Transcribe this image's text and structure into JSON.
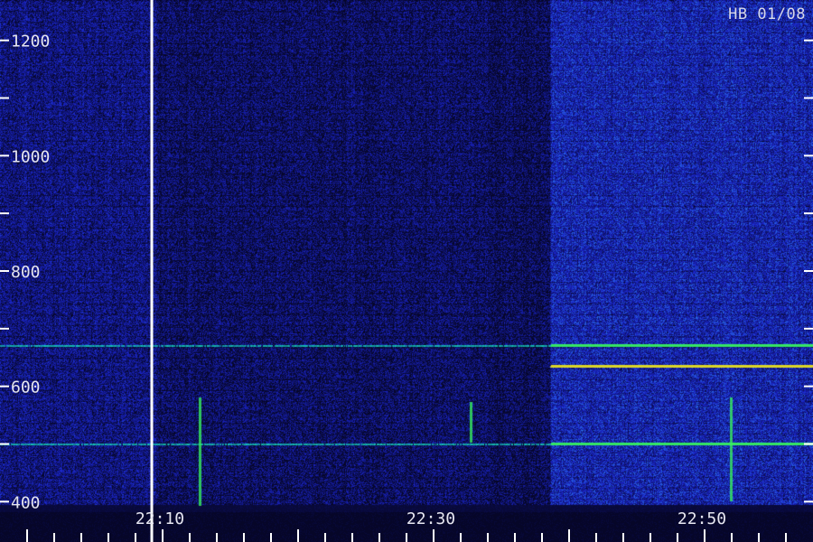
{
  "stamp": "HB 01/08",
  "chart_data": {
    "type": "heatmap",
    "title": "",
    "xlabel": "",
    "ylabel": "",
    "x_tick_labels": [
      "22:10",
      "22:30",
      "22:50"
    ],
    "y_tick_labels": [
      "400",
      "600",
      "800",
      "1000",
      "1200"
    ],
    "y_ticks": [
      400,
      600,
      800,
      1000,
      1200
    ],
    "ylim": [
      330,
      1270
    ],
    "x_tick_times_min": [
      10,
      30,
      50
    ],
    "xlim_min": [
      -2,
      58
    ],
    "marker_line_min": 9.2,
    "gain_step_min": 38.6,
    "colors": {
      "background_low": "#08084a",
      "background_high": "#1e3ad6",
      "trace_cyan": "#18d8c0",
      "trace_green": "#38f060",
      "trace_yellow": "#e8e020",
      "marker": "#ffffff"
    },
    "series": [
      {
        "name": "",
        "freq_hz": 672,
        "start_min": -2,
        "end_min": 58
      },
      {
        "name": "",
        "freq_hz": 636,
        "start_min": 38.6,
        "end_min": 58
      },
      {
        "name": "",
        "freq_hz": 500,
        "start_min": -2,
        "end_min": 58
      }
    ]
  }
}
